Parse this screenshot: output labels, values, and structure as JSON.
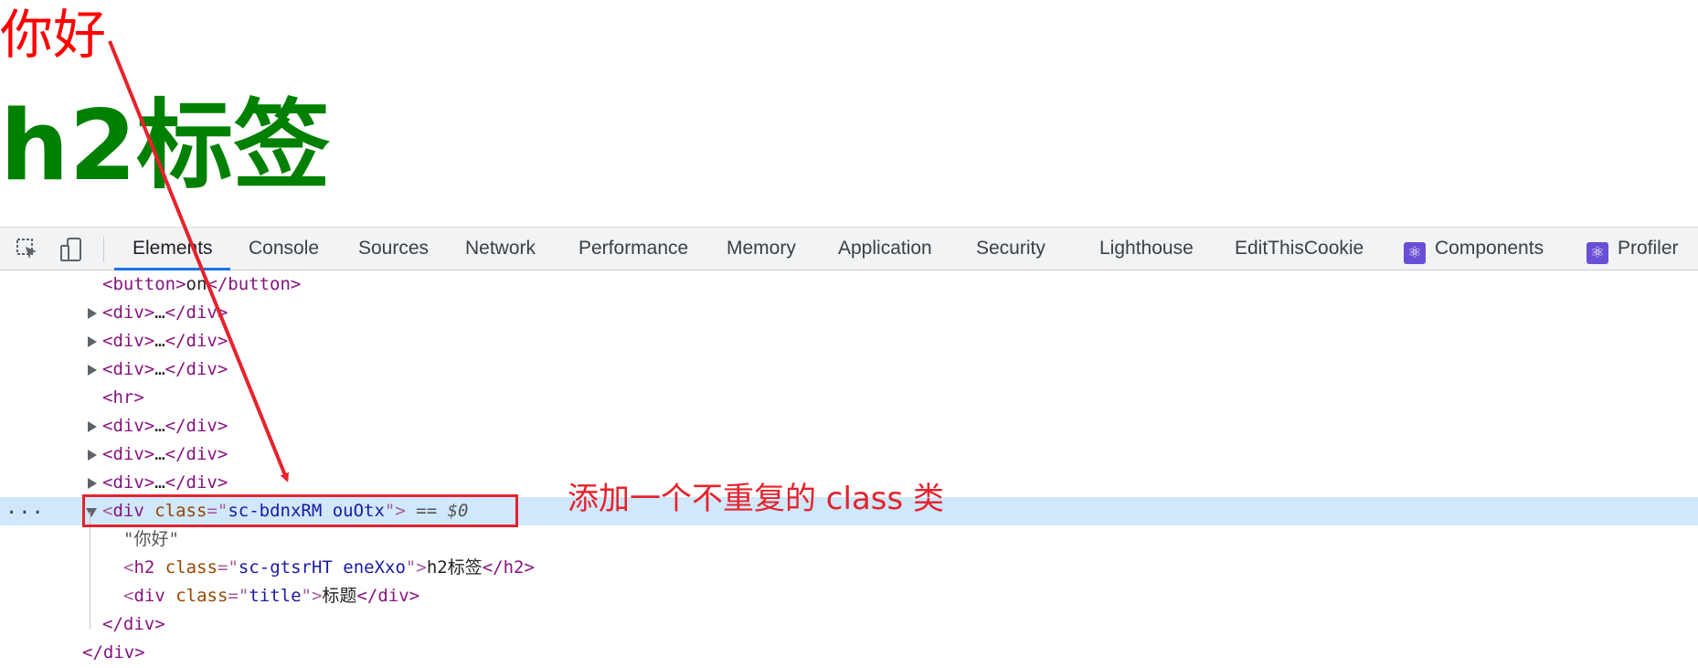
{
  "page": {
    "text_node": "你好",
    "h2_text": "h2标签"
  },
  "devtools": {
    "tabs": [
      {
        "label": "Elements",
        "active": true
      },
      {
        "label": "Console"
      },
      {
        "label": "Sources"
      },
      {
        "label": "Network"
      },
      {
        "label": "Performance"
      },
      {
        "label": "Memory"
      },
      {
        "label": "Application"
      },
      {
        "label": "Security"
      },
      {
        "label": "Lighthouse"
      },
      {
        "label": "EditThisCookie"
      },
      {
        "label": "Components",
        "icon": "react-icon"
      },
      {
        "label": "Profiler",
        "icon": "react-icon"
      }
    ],
    "accent_color": "#1a73e8"
  },
  "tree": {
    "button": {
      "open": "<button>",
      "text": "on",
      "close": "</button>"
    },
    "collapsed_div": {
      "open": "<div>",
      "ellipsis": "…",
      "close": "</div>"
    },
    "hr": "<hr>",
    "selected": {
      "open_bracket": "<",
      "tag": "div",
      "attr": "class",
      "eq_quote": "=\"",
      "value": "sc-bdnxRM ouOtx",
      "close_quote": "\"",
      "close_bracket": ">",
      "suffix": "== $0",
      "dots": "..."
    },
    "text_node": "\"你好\"",
    "h2": {
      "tag": "h2",
      "attr": "class",
      "value": "sc-gtsrHT eneXxo",
      "text": "h2标签",
      "close": "</h2>"
    },
    "title_div": {
      "tag": "div",
      "attr": "class",
      "value": "title",
      "text": "标题",
      "close": "</div>"
    },
    "close_div_inner": "</div>",
    "close_div_outer": "</div>"
  },
  "annotation": {
    "text": "添加一个不重复的 class 类",
    "color": "#e6222c"
  }
}
